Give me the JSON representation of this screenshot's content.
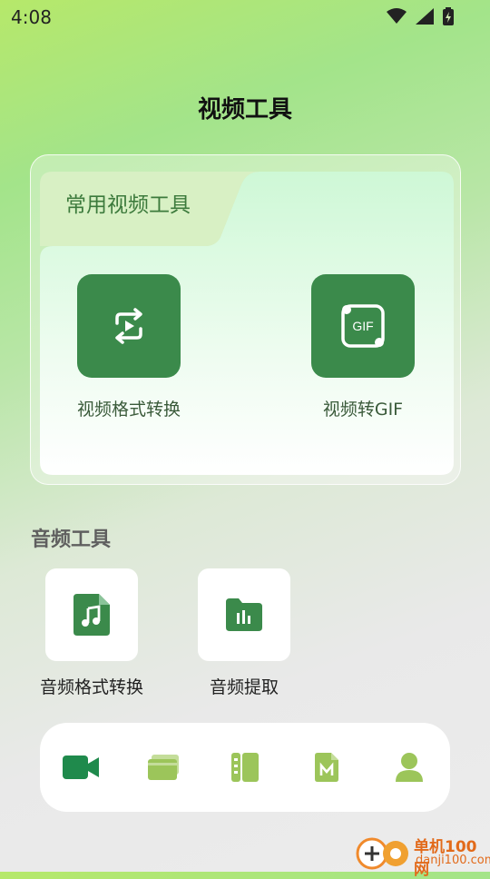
{
  "status_bar": {
    "time": "4:08"
  },
  "page": {
    "title": "视频工具"
  },
  "video_card": {
    "heading": "常用视频工具",
    "tools": [
      {
        "label": "视频格式转换",
        "icon": "repeat-play-icon"
      },
      {
        "label": "视频转GIF",
        "icon": "gif-icon",
        "icon_text": "GIF"
      }
    ]
  },
  "audio_section": {
    "title": "音频工具",
    "tools": [
      {
        "label": "音频格式转换",
        "icon": "music-file-icon"
      },
      {
        "label": "音频提取",
        "icon": "audio-folder-icon"
      }
    ]
  },
  "bottom_nav": {
    "items": [
      {
        "icon": "video-camera-icon",
        "active": true
      },
      {
        "icon": "card-icon",
        "active": false
      },
      {
        "icon": "notebook-icon",
        "active": false
      },
      {
        "icon": "m-document-icon",
        "active": false
      },
      {
        "icon": "user-icon",
        "active": false
      }
    ]
  },
  "watermark": {
    "name": "单机100网",
    "url": "danji100.com"
  },
  "colors": {
    "primary": "#3b8a4b",
    "nav_active": "#1f8a4c",
    "nav_inactive": "#9cc55a",
    "brand_orange": "#e26a1a"
  }
}
